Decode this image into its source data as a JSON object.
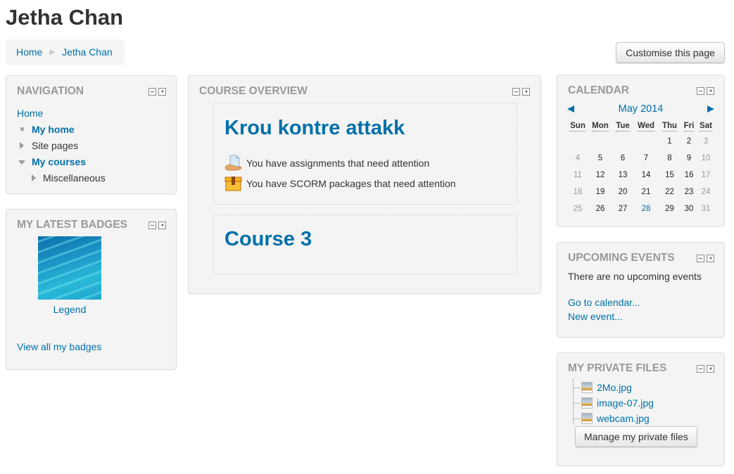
{
  "page": {
    "title": "Jetha Chan"
  },
  "breadcrumb": {
    "items": [
      "Home",
      "Jetha Chan"
    ],
    "separator": "▶"
  },
  "toolbar": {
    "customise_label": "Customise this page"
  },
  "navigation": {
    "title": "NAVIGATION",
    "items": [
      {
        "label": "Home",
        "level": 0,
        "bold": false,
        "marker": "none",
        "link": true
      },
      {
        "label": "My home",
        "level": 1,
        "bold": true,
        "marker": "square",
        "link": true
      },
      {
        "label": "Site pages",
        "level": 1,
        "bold": false,
        "marker": "collapsed",
        "link": false
      },
      {
        "label": "My courses",
        "level": 1,
        "bold": true,
        "marker": "expanded",
        "link": true
      },
      {
        "label": "Miscellaneous",
        "level": 2,
        "bold": false,
        "marker": "collapsed",
        "link": false
      }
    ]
  },
  "badges": {
    "title": "MY LATEST BADGES",
    "items": [
      {
        "name": "Legend",
        "image": "badge-image"
      }
    ],
    "view_all": "View all my badges"
  },
  "course_overview": {
    "title": "COURSE OVERVIEW",
    "courses": [
      {
        "name": "Krou kontre attakk",
        "alerts": [
          {
            "icon": "assignment-icon",
            "text": "You have assignments that need attention"
          },
          {
            "icon": "scorm-package-icon",
            "text": "You have SCORM packages that need attention"
          }
        ]
      },
      {
        "name": "Course 3",
        "alerts": []
      }
    ]
  },
  "calendar": {
    "title": "CALENDAR",
    "month_label": "May 2014",
    "prev_icon": "◀",
    "next_icon": "▶",
    "weekdays": [
      "Sun",
      "Mon",
      "Tue",
      "Wed",
      "Thu",
      "Fri",
      "Sat"
    ],
    "weeks": [
      [
        "",
        "",
        "",
        "",
        "1",
        "2",
        "3"
      ],
      [
        "4",
        "5",
        "6",
        "7",
        "8",
        "9",
        "10"
      ],
      [
        "11",
        "12",
        "13",
        "14",
        "15",
        "16",
        "17"
      ],
      [
        "18",
        "19",
        "20",
        "21",
        "22",
        "23",
        "24"
      ],
      [
        "25",
        "26",
        "27",
        "28",
        "29",
        "30",
        "31"
      ]
    ],
    "today": "28"
  },
  "upcoming_events": {
    "title": "UPCOMING EVENTS",
    "empty_text": "There are no upcoming events",
    "go_to_calendar": "Go to calendar...",
    "new_event": "New event..."
  },
  "private_files": {
    "title": "MY PRIVATE FILES",
    "files": [
      "2Mo.jpg",
      "image-07.jpg",
      "webcam.jpg"
    ],
    "manage_label": "Manage my private files"
  },
  "colors": {
    "link": "#0070a8",
    "block_bg": "#f4f4f4",
    "block_title": "#999999",
    "text": "#333333",
    "weekend": "#999999"
  }
}
